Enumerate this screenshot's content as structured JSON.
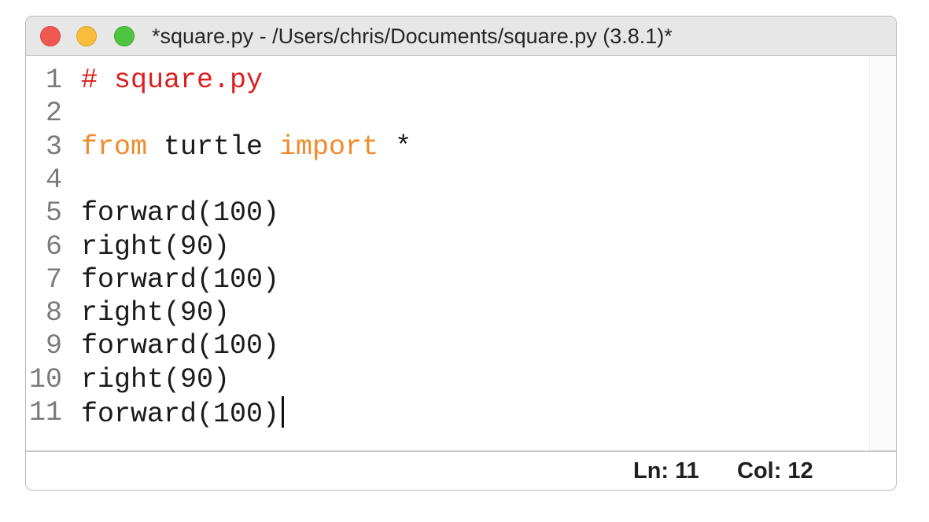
{
  "window": {
    "title": "*square.py - /Users/chris/Documents/square.py (3.8.1)*",
    "traffic_lights": {
      "close_color": "#ee5a52",
      "minimize_color": "#f7bd3b",
      "zoom_color": "#4fc440"
    }
  },
  "editor": {
    "colors": {
      "comment": "#dd1e1e",
      "keyword": "#f08a2b",
      "text": "#1a1a1a",
      "line_number": "#7a7a7a"
    },
    "lines": [
      {
        "number": "1",
        "tokens": [
          {
            "type": "comment",
            "text": "# square.py"
          }
        ]
      },
      {
        "number": "2",
        "tokens": []
      },
      {
        "number": "3",
        "tokens": [
          {
            "type": "keyword",
            "text": "from"
          },
          {
            "type": "plain",
            "text": " turtle "
          },
          {
            "type": "keyword",
            "text": "import"
          },
          {
            "type": "plain",
            "text": " *"
          }
        ]
      },
      {
        "number": "4",
        "tokens": []
      },
      {
        "number": "5",
        "tokens": [
          {
            "type": "plain",
            "text": "forward(100)"
          }
        ]
      },
      {
        "number": "6",
        "tokens": [
          {
            "type": "plain",
            "text": "right(90)"
          }
        ]
      },
      {
        "number": "7",
        "tokens": [
          {
            "type": "plain",
            "text": "forward(100)"
          }
        ]
      },
      {
        "number": "8",
        "tokens": [
          {
            "type": "plain",
            "text": "right(90)"
          }
        ]
      },
      {
        "number": "9",
        "tokens": [
          {
            "type": "plain",
            "text": "forward(100)"
          }
        ]
      },
      {
        "number": "10",
        "tokens": [
          {
            "type": "plain",
            "text": "right(90)"
          }
        ]
      },
      {
        "number": "11",
        "tokens": [
          {
            "type": "plain",
            "text": "forward(100)"
          }
        ],
        "cursor": true
      }
    ]
  },
  "status": {
    "line": "Ln: 11",
    "column": "Col: 12"
  }
}
